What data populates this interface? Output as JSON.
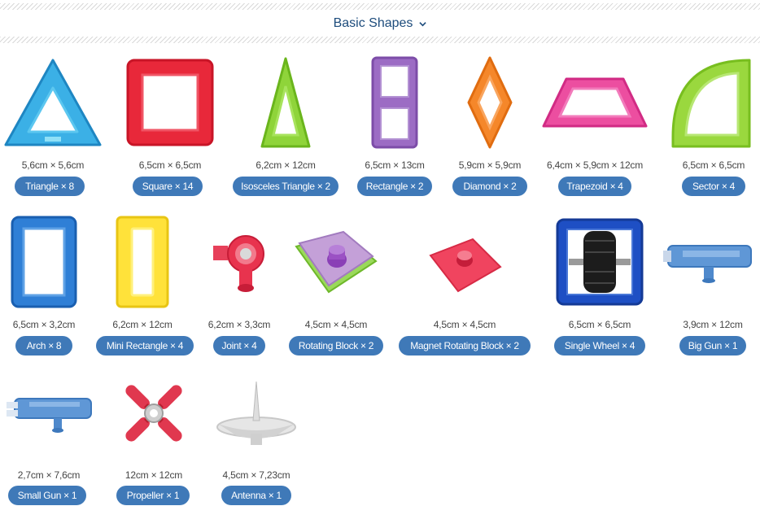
{
  "header": {
    "title": "Basic Shapes",
    "chevron_icon": "chevron-down-icon"
  },
  "colors": {
    "title": "#1d4c7c",
    "pill": "#3f79b8"
  },
  "items": [
    {
      "name": "Triangle × 8",
      "dims": "5,6cm × 5,6cm",
      "icon": "triangle-piece-icon"
    },
    {
      "name": "Square × 14",
      "dims": "6,5cm × 6,5cm",
      "icon": "square-piece-icon"
    },
    {
      "name": "Isosceles Triangle × 2",
      "dims": "6,2cm × 12cm",
      "icon": "isosceles-triangle-piece-icon"
    },
    {
      "name": "Rectangle × 2",
      "dims": "6,5cm × 13cm",
      "icon": "rectangle-piece-icon"
    },
    {
      "name": "Diamond × 2",
      "dims": "5,9cm × 5,9cm",
      "icon": "diamond-piece-icon"
    },
    {
      "name": "Trapezoid × 4",
      "dims": "6,4cm × 5,9cm × 12cm",
      "icon": "trapezoid-piece-icon"
    },
    {
      "name": "Sector × 4",
      "dims": "6,5cm × 6,5cm",
      "icon": "sector-piece-icon"
    },
    {
      "name": "Arch × 8",
      "dims": "6,5cm × 3,2cm",
      "icon": "arch-piece-icon"
    },
    {
      "name": "Mini Rectangle × 4",
      "dims": "6,2cm × 12cm",
      "icon": "mini-rectangle-piece-icon"
    },
    {
      "name": "Joint × 4",
      "dims": "6,2cm × 3,3cm",
      "icon": "joint-piece-icon"
    },
    {
      "name": "Rotating Block × 2",
      "dims": "4,5cm × 4,5cm",
      "icon": "rotating-block-piece-icon"
    },
    {
      "name": "Magnet Rotating Block × 2",
      "dims": "4,5cm × 4,5cm",
      "icon": "magnet-rotating-block-piece-icon"
    },
    {
      "name": "Single Wheel × 4",
      "dims": "6,5cm × 6,5cm",
      "icon": "single-wheel-piece-icon"
    },
    {
      "name": "Big Gun × 1",
      "dims": "3,9cm × 12cm",
      "icon": "big-gun-piece-icon"
    },
    {
      "name": "Small Gun × 1",
      "dims": "2,7cm × 7,6cm",
      "icon": "small-gun-piece-icon"
    },
    {
      "name": "Propeller × 1",
      "dims": "12cm × 12cm",
      "icon": "propeller-piece-icon"
    },
    {
      "name": "Antenna × 1",
      "dims": "4,5cm × 7,23cm",
      "icon": "antenna-piece-icon"
    }
  ]
}
